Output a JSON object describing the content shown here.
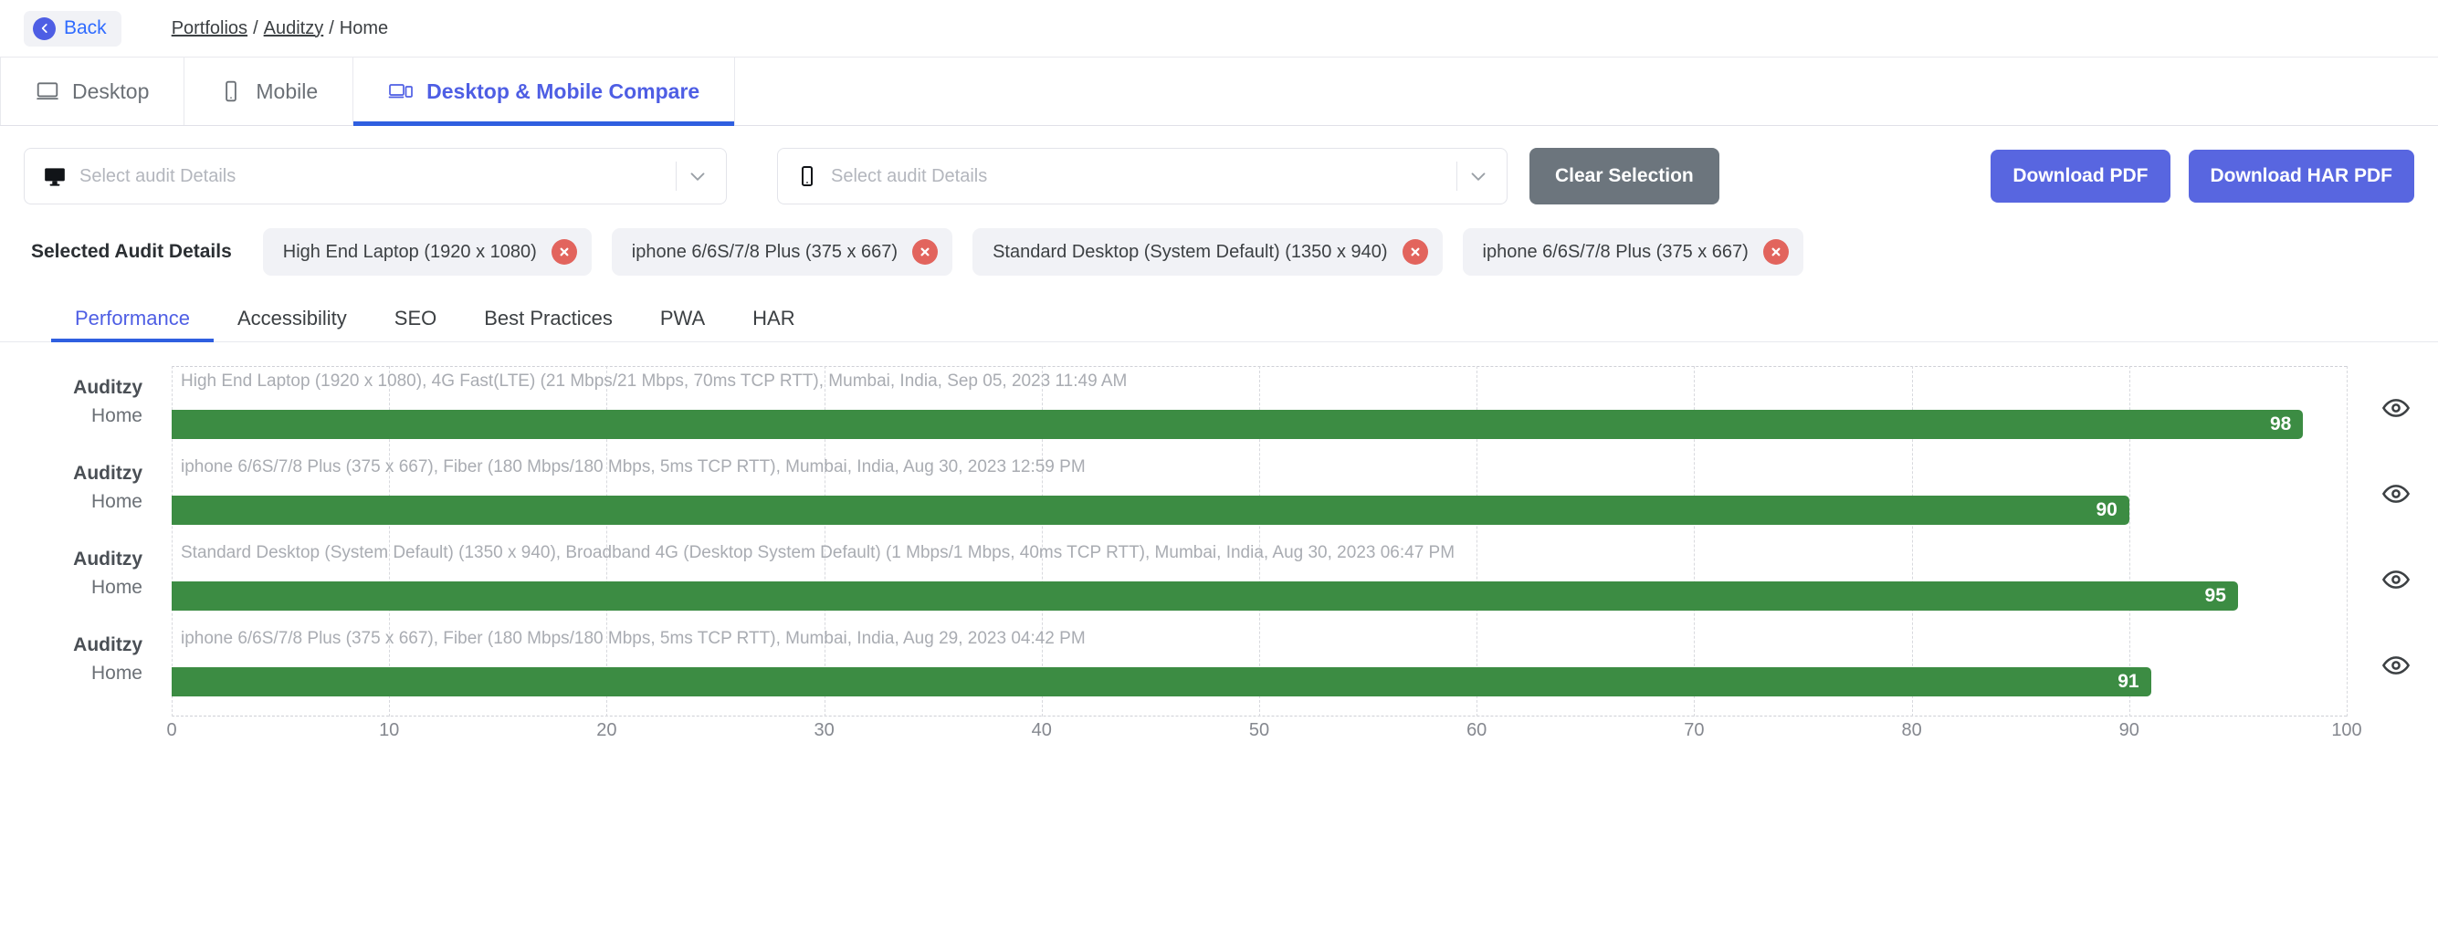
{
  "header": {
    "back_label": "Back",
    "breadcrumb": [
      {
        "label": "Portfolios",
        "link": true
      },
      {
        "label": "Auditzy",
        "link": true
      },
      {
        "label": "Home",
        "link": false
      }
    ],
    "separator": "/"
  },
  "main_tabs": [
    {
      "label": "Desktop",
      "icon": "desktop-icon",
      "active": false
    },
    {
      "label": "Mobile",
      "icon": "mobile-icon",
      "active": false
    },
    {
      "label": "Desktop & Mobile Compare",
      "icon": "desktop-mobile-compare-icon",
      "active": true
    }
  ],
  "toolbar": {
    "desktop_select": {
      "placeholder": "Select audit Details",
      "value": "",
      "icon": "desktop-icon"
    },
    "mobile_select": {
      "placeholder": "Select audit Details",
      "value": "",
      "icon": "mobile-icon"
    },
    "clear_selection_label": "Clear Selection",
    "download_pdf_label": "Download PDF",
    "download_har_pdf_label": "Download HAR PDF",
    "primary_color": "#5866e0",
    "secondary_color": "#6c757d"
  },
  "selected_audits": {
    "label": "Selected Audit Details",
    "remove_icon": "close-circle-icon",
    "remove_color": "#e2645d",
    "chips": [
      "High End Laptop (1920 x 1080)",
      "iphone 6/6S/7/8 Plus (375 x 667)",
      "Standard Desktop (System Default) (1350 x 940)",
      "iphone 6/6S/7/8 Plus (375 x 667)"
    ]
  },
  "sub_tabs": [
    {
      "label": "Performance",
      "active": true
    },
    {
      "label": "Accessibility",
      "active": false
    },
    {
      "label": "SEO",
      "active": false
    },
    {
      "label": "Best Practices",
      "active": false
    },
    {
      "label": "PWA",
      "active": false
    },
    {
      "label": "HAR",
      "active": false
    }
  ],
  "chart_data": {
    "type": "bar",
    "orientation": "horizontal",
    "title": "",
    "xlabel": "",
    "ylabel": "",
    "xlim": [
      0,
      100
    ],
    "xticks": [
      0,
      10,
      20,
      30,
      40,
      50,
      60,
      70,
      80,
      90,
      100
    ],
    "grid": true,
    "legend": "none",
    "bar_color": "#3c8c43",
    "categories": [
      "Auditzy Home",
      "Auditzy Home",
      "Auditzy Home",
      "Auditzy Home"
    ],
    "values": [
      98,
      90,
      95,
      91
    ],
    "annotations": [
      "High End Laptop (1920 x 1080), 4G Fast(LTE) (21 Mbps/21 Mbps, 70ms TCP RTT), Mumbai, India, Sep 05, 2023 11:49 AM",
      "iphone 6/6S/7/8 Plus (375 x 667), Fiber (180 Mbps/180 Mbps, 5ms TCP RTT), Mumbai, India, Aug 30, 2023 12:59 PM",
      "Standard Desktop (System Default) (1350 x 940), Broadband 4G (Desktop System Default) (1 Mbps/1 Mbps, 40ms TCP RTT), Mumbai, India, Aug 30, 2023 06:47 PM",
      "iphone 6/6S/7/8 Plus (375 x 667), Fiber (180 Mbps/180 Mbps, 5ms TCP RTT), Mumbai, India, Aug 29, 2023 04:42 PM"
    ],
    "rows": [
      {
        "site": "Auditzy",
        "page": "Home",
        "value": 98,
        "action_icon": "eye-icon"
      },
      {
        "site": "Auditzy",
        "page": "Home",
        "value": 90,
        "action_icon": "eye-icon"
      },
      {
        "site": "Auditzy",
        "page": "Home",
        "value": 95,
        "action_icon": "eye-icon"
      },
      {
        "site": "Auditzy",
        "page": "Home",
        "value": 91,
        "action_icon": "eye-icon"
      }
    ]
  }
}
